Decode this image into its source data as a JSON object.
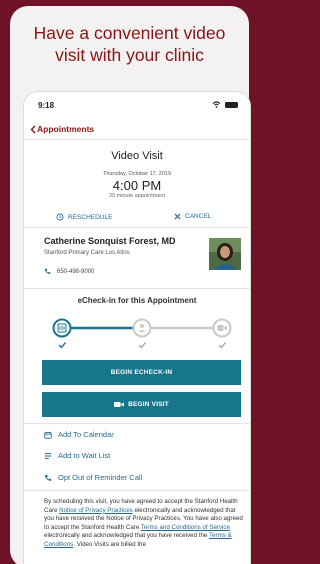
{
  "headline": {
    "line1": "Have a convenient video",
    "line2": "visit with your clinic"
  },
  "status_bar": {
    "time": "9:18"
  },
  "nav": {
    "back_label": "Appointments"
  },
  "visit": {
    "title": "Video Visit",
    "date": "Thursday, October 17, 2019",
    "time": "4:00 PM",
    "duration": "20 minute appointment"
  },
  "actions": {
    "reschedule": "RESCHEDULE",
    "cancel": "CANCEL"
  },
  "provider": {
    "name": "Catherine Sonquist Forest, MD",
    "clinic": "Stanford Primary Care Los Altos",
    "phone": "650-498-9000"
  },
  "echeckin": {
    "heading": "eCheck-in for this Appointment",
    "begin_label": "BEGIN ECHECK-IN",
    "begin_visit_label": "BEGIN VISIT"
  },
  "links": {
    "calendar": "Add To Calendar",
    "waitlist": "Add to Wait List",
    "optout": "Opt Out of Reminder Call"
  },
  "fine_print": {
    "p1": "By scheduling this visit, you have agreed to accept the Stanford Health Care ",
    "link1": "Notice of Privacy Practices",
    "p2": " electronically and acknowledged that you have received the Notice of Privacy Practices. You have also agreed to accept the Stanford Health Care ",
    "link2": "Terms and Conditions of Service",
    "p3": " electronically and acknowledged that you have received the ",
    "link3": "Terms & Conditions",
    "p4": ". Video Visits are billed the"
  },
  "colors": {
    "background": "#6e1327",
    "accent_red": "#8c1515",
    "teal_button": "#17758c",
    "link_blue": "#236b8e"
  }
}
